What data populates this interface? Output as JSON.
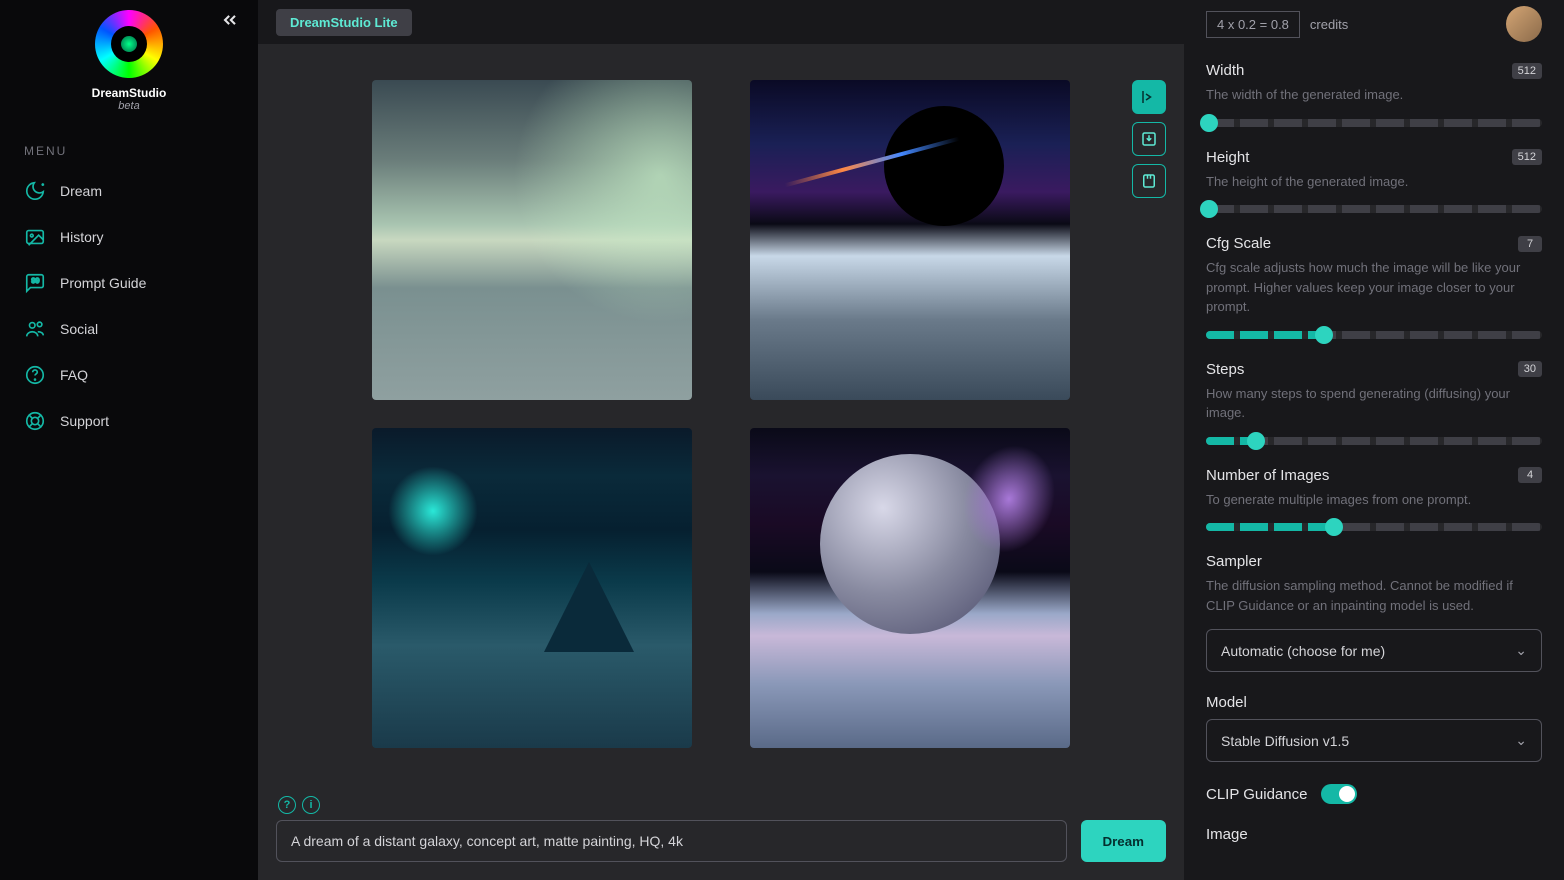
{
  "app": {
    "title": "DreamStudio",
    "subtitle": "beta",
    "lite_badge": "DreamStudio Lite"
  },
  "menu": {
    "label": "MENU",
    "items": [
      {
        "label": "Dream"
      },
      {
        "label": "History"
      },
      {
        "label": "Prompt Guide"
      },
      {
        "label": "Social"
      },
      {
        "label": "FAQ"
      },
      {
        "label": "Support"
      }
    ]
  },
  "credits": {
    "calc": "4 x 0.2 = 0.8",
    "label": "credits"
  },
  "prompt": {
    "value": "A dream of a distant galaxy, concept art, matte painting, HQ, 4k",
    "button": "Dream"
  },
  "settings": {
    "width": {
      "title": "Width",
      "value": "512",
      "desc": "The width of the generated image.",
      "pct": 0
    },
    "height": {
      "title": "Height",
      "value": "512",
      "desc": "The height of the generated image.",
      "pct": 0
    },
    "cfg": {
      "title": "Cfg Scale",
      "value": "7",
      "desc": "Cfg scale adjusts how much the image will be like your prompt. Higher values keep your image closer to your prompt.",
      "pct": 35
    },
    "steps": {
      "title": "Steps",
      "value": "30",
      "desc": "How many steps to spend generating (diffusing) your image.",
      "pct": 15
    },
    "num": {
      "title": "Number of Images",
      "value": "4",
      "desc": "To generate multiple images from one prompt.",
      "pct": 38
    },
    "sampler": {
      "title": "Sampler",
      "desc": "The diffusion sampling method. Cannot be modified if CLIP Guidance or an inpainting model is used.",
      "selected": "Automatic (choose for me)"
    },
    "model": {
      "title": "Model",
      "selected": "Stable Diffusion v1.5"
    },
    "clip": {
      "title": "CLIP Guidance"
    },
    "image": {
      "title": "Image"
    }
  }
}
